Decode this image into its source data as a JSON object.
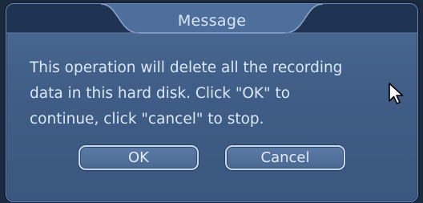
{
  "dialog": {
    "title": "Message",
    "message_lines": [
      "This operation will delete all the recording",
      "data in this hard disk. Click \"OK\" to",
      "continue, click \"cancel\" to stop."
    ],
    "ok_label": "OK",
    "cancel_label": "Cancel"
  },
  "icons": {
    "cursor": "mouse-pointer-icon"
  },
  "colors": {
    "dialog_bg": "#3f5d86",
    "header_dark": "#1f3352",
    "text": "#dbe8f7",
    "button_border": "#c9d8ea"
  }
}
